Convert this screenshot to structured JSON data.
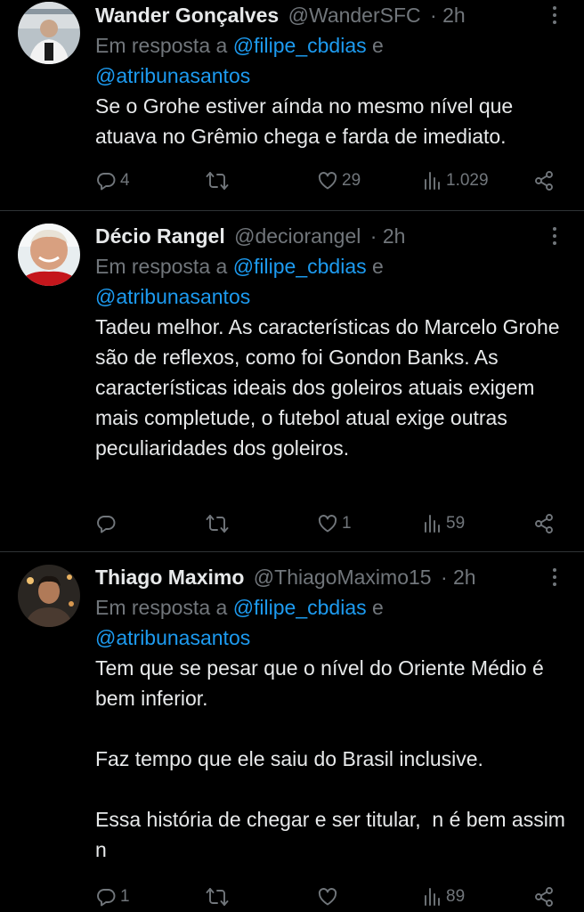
{
  "tweets": [
    {
      "name": "Wander Gonçalves",
      "handle": "@WanderSFC",
      "time": "· 2h",
      "reply_prefix": "Em resposta a ",
      "reply_mention_1": "@filipe_cbdias",
      "reply_and": " e",
      "reply_mention_2": "@atribunasantos",
      "text": "Se o Grohe estiver aínda no mesmo nível que atuava no Grêmio chega e farda de imediato.",
      "replies": "4",
      "retweets": "",
      "likes": "29",
      "views": "1.029"
    },
    {
      "name": "Décio Rangel",
      "handle": "@deciorangel",
      "time": "· 2h",
      "reply_prefix": "Em resposta a ",
      "reply_mention_1": "@filipe_cbdias",
      "reply_and": " e",
      "reply_mention_2": "@atribunasantos",
      "text": "Tadeu melhor. As características do Marcelo Grohe são de reflexos, como foi Gondon Banks. As características ideais dos goleiros atuais exigem mais completude, o futebol atual exige outras peculiaridades dos goleiros.",
      "replies": "",
      "retweets": "",
      "likes": "1",
      "views": "59"
    },
    {
      "name": "Thiago Maximo",
      "handle": "@ThiagoMaximo15",
      "time": "· 2h",
      "reply_prefix": "Em resposta a ",
      "reply_mention_1": "@filipe_cbdias",
      "reply_and": " e",
      "reply_mention_2": "@atribunasantos",
      "text": "Tem que se pesar que o nível do Oriente Médio é bem inferior.\n\nFaz tempo que ele saiu do Brasil inclusive.\n\nEssa história de chegar e ser titular,  n é bem assim n",
      "replies": "1",
      "retweets": "",
      "likes": "",
      "views": "89"
    }
  ],
  "colors": {
    "background": "#000000",
    "text": "#e7e9ea",
    "muted": "#71767b",
    "link": "#1d9bf0",
    "divider": "#2f3336"
  },
  "icons": [
    "reply-icon",
    "retweet-icon",
    "like-icon",
    "views-icon",
    "share-icon",
    "more-icon"
  ]
}
